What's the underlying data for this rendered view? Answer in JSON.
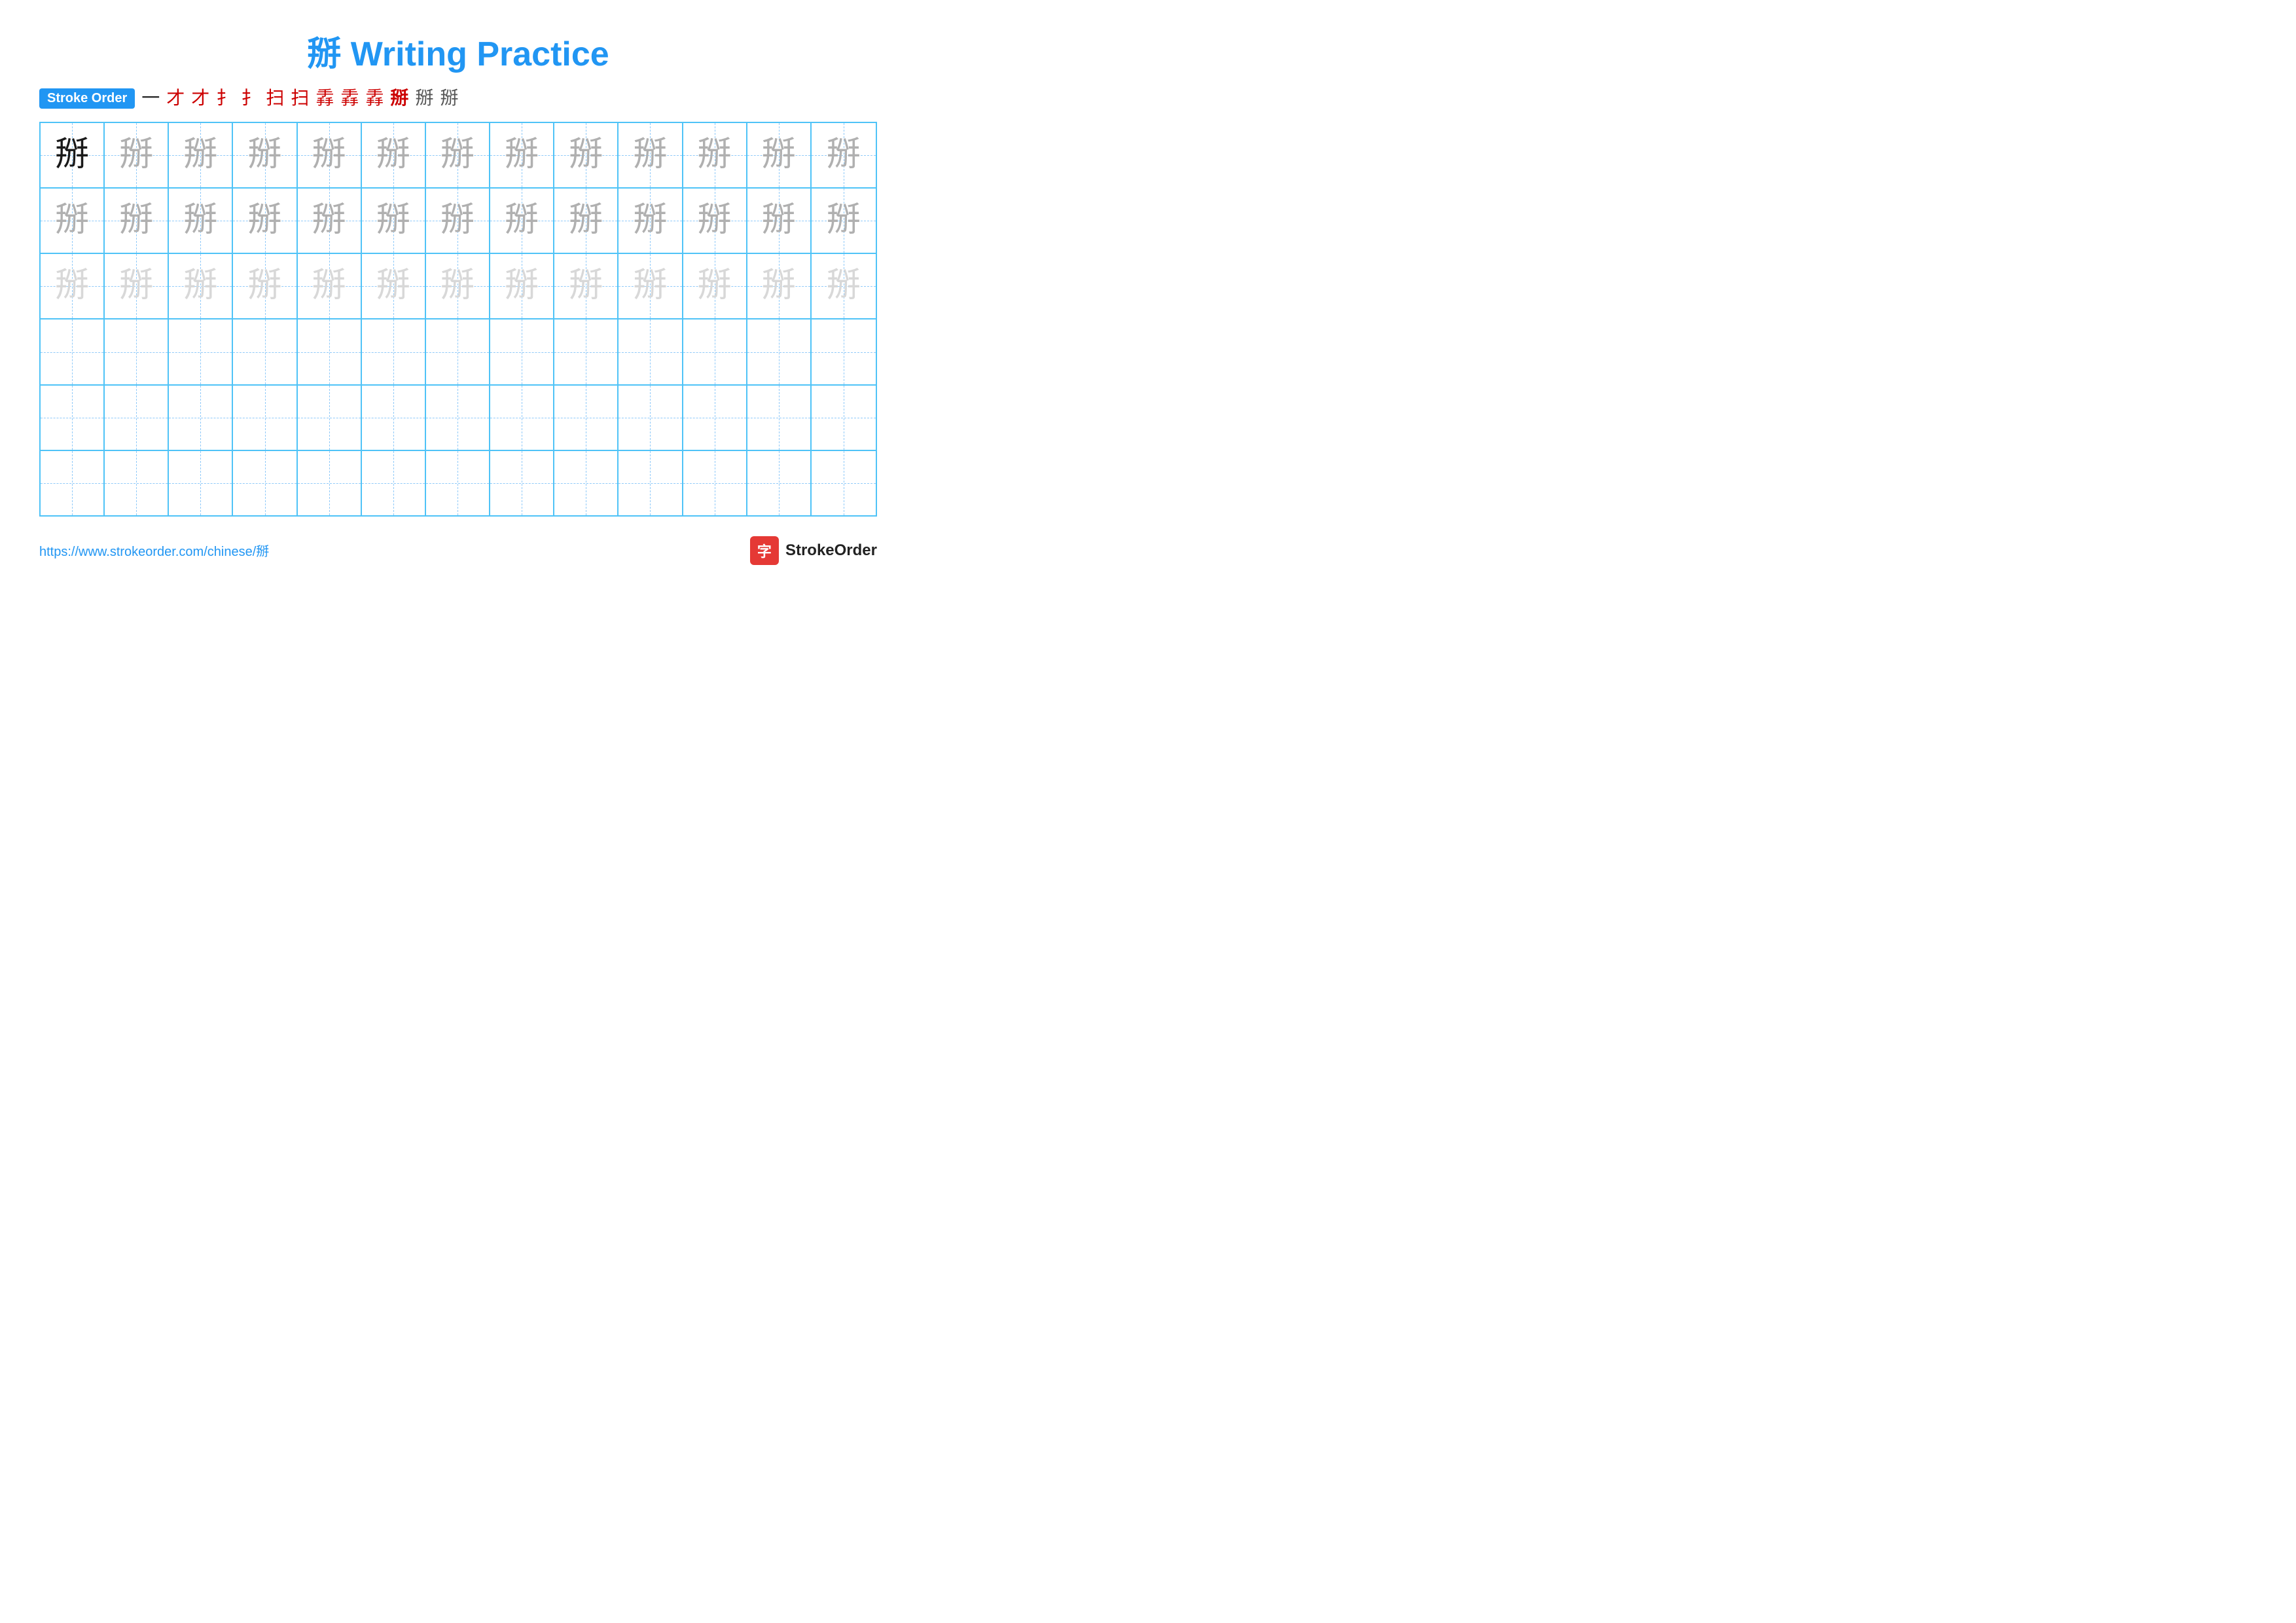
{
  "title": "掰 Writing Practice",
  "stroke_order": {
    "badge": "Stroke Order",
    "steps": [
      "一",
      "才",
      "才",
      "扌",
      "扌",
      "扫",
      "扫",
      "扫",
      "扫'",
      "扫'",
      "掰",
      "掰",
      "掰"
    ]
  },
  "main_char": "掰",
  "grid": {
    "rows": 6,
    "cols": 13,
    "row_types": [
      "dark-medium",
      "medium",
      "light",
      "empty",
      "empty",
      "empty"
    ]
  },
  "footer": {
    "url": "https://www.strokeorder.com/chinese/掰",
    "logo_char": "字",
    "logo_text": "StrokeOrder"
  }
}
